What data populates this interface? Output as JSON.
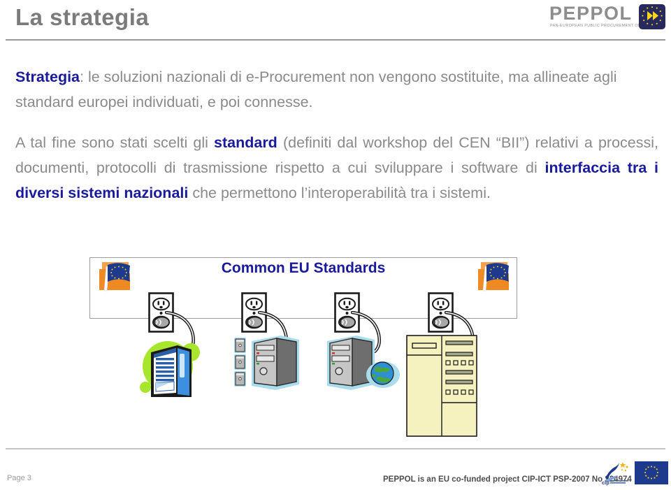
{
  "header": {
    "title": "La strategia",
    "logo": {
      "wordmark": "PEPPOL",
      "tagline": "PAN-EUROPEAN PUBLIC PROCUREMENT ONLINE",
      "mark_icon": "peppol-arrows-eu-stars-icon",
      "mark_color": "#28295c"
    }
  },
  "content": {
    "paragraph_1": {
      "lead_bold": "Strategia",
      "rest": ": le soluzioni nazionali di e-Procurement non vengono sostituite, ma allineate agli standard europei individuati, e poi connesse."
    },
    "paragraph_2": {
      "part_1": "A tal fine sono stati scelti gli ",
      "bold_1": "standard",
      "part_2": " (definiti dal workshop del CEN “BII”) relativi a processi, documenti, protocolli di trasmissione rispetto a cui sviluppare i software di ",
      "bold_2": "interfaccia tra i diversi sistemi nazionali",
      "part_3": " che permettono l’interoperabilità tra i sistemi."
    }
  },
  "diagram": {
    "box_label": "Common EU Standards",
    "box_label_color": "#1a1a9c",
    "box_border_color": "#9c9c9c",
    "flag_icons": [
      "eu-flag-document-icon",
      "eu-flag-document-icon"
    ],
    "outlets": [
      {
        "name": "power-outlet-1",
        "icon": "power-outlet-icon"
      },
      {
        "name": "power-outlet-2",
        "icon": "power-outlet-icon"
      },
      {
        "name": "power-outlet-3",
        "icon": "power-outlet-icon"
      },
      {
        "name": "power-outlet-4",
        "icon": "power-outlet-icon"
      }
    ],
    "nodes": [
      {
        "name": "server-rack-node",
        "icon": "server-rack-icon"
      },
      {
        "name": "pc-cluster-node",
        "icon": "desktop-pc-with-devices-icon"
      },
      {
        "name": "pc-globe-node",
        "icon": "desktop-pc-with-globe-icon"
      },
      {
        "name": "mainframe-node",
        "icon": "mainframe-cabinet-icon"
      }
    ]
  },
  "footer": {
    "page_number": "Page 3",
    "note": "PEPPOL is an EU co-funded project CIP-ICT PSP-2007 No 224974",
    "cip_logo_icon": "cip-running-figure-icon",
    "eu_flag_icon": "eu-flag-icon"
  },
  "colors": {
    "title_gray": "#7b7b7b",
    "body_gray": "#8a8a8a",
    "accent_blue": "#1a1a9c",
    "flag_blue": "#1d3a8f",
    "flag_gold": "#ffcc00",
    "folder_orange": "#f08a23"
  }
}
